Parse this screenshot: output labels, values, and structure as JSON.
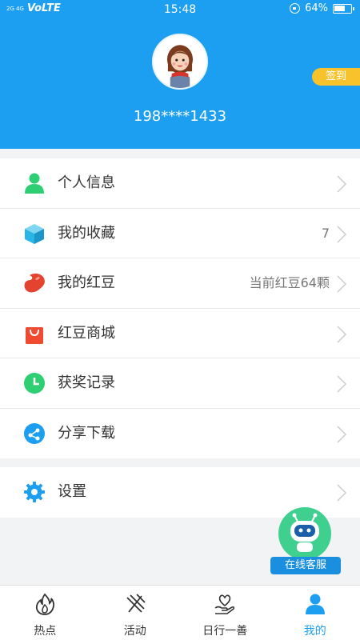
{
  "status_bar": {
    "signal_text": "2G 4G",
    "network": "VoLTE",
    "time": "15:48",
    "battery": "64%"
  },
  "profile": {
    "phone": "198****1433",
    "signin_label": "签到"
  },
  "menu": [
    {
      "label": "个人信息",
      "value": "",
      "icon": "person-icon",
      "color": "#2ecf73"
    },
    {
      "label": "我的收藏",
      "value": "7",
      "icon": "box-icon",
      "color": "#29b6e6"
    },
    {
      "label": "我的红豆",
      "value": "当前红豆64颗",
      "icon": "bean-icon",
      "color": "#e3432f"
    },
    {
      "label": "红豆商城",
      "value": "",
      "icon": "shopping-bag-icon",
      "color": "#ef4b31"
    },
    {
      "label": "获奖记录",
      "value": "",
      "icon": "clock-icon",
      "color": "#2ecf73"
    },
    {
      "label": "分享下载",
      "value": "",
      "icon": "share-icon",
      "color": "#1c9ff0"
    }
  ],
  "settings": {
    "label": "设置",
    "icon": "gear-icon",
    "color": "#1c9ff0"
  },
  "customer_service": {
    "label": "在线客服"
  },
  "tabs": [
    {
      "label": "热点",
      "icon": "flame-icon",
      "active": false
    },
    {
      "label": "活动",
      "icon": "activity-icon",
      "active": false
    },
    {
      "label": "日行一善",
      "icon": "heart-hand-icon",
      "active": false
    },
    {
      "label": "我的",
      "icon": "user-icon",
      "active": true
    }
  ],
  "colors": {
    "primary": "#1c9ff0",
    "signin": "#f7c22b",
    "service_bot": "#3fd08f"
  }
}
